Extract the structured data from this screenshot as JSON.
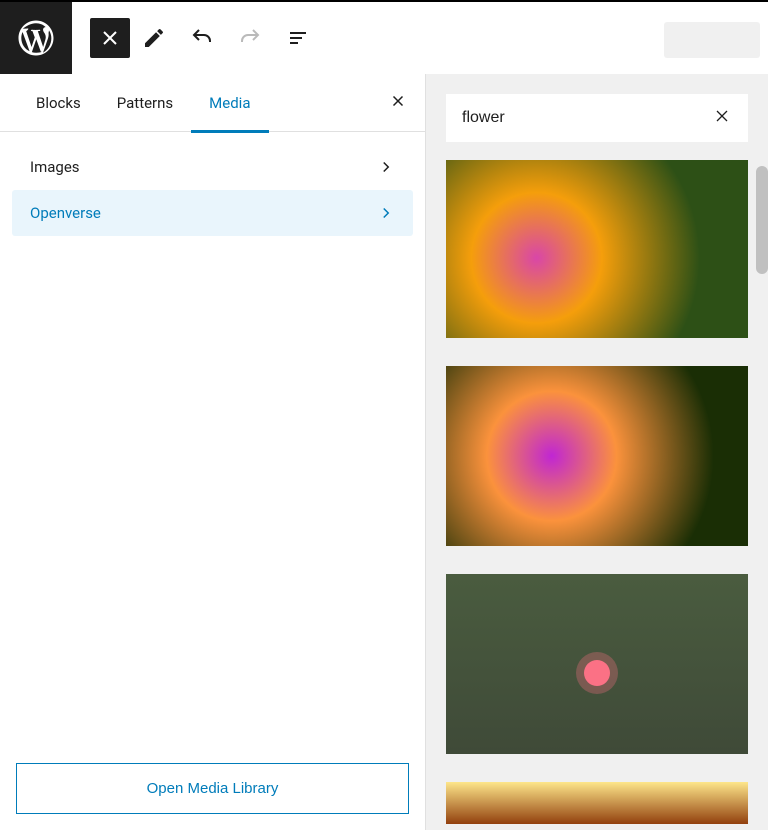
{
  "inserter": {
    "tabs": [
      {
        "label": "Blocks",
        "active": false
      },
      {
        "label": "Patterns",
        "active": false
      },
      {
        "label": "Media",
        "active": true
      }
    ],
    "categories": [
      {
        "label": "Images",
        "selected": false
      },
      {
        "label": "Openverse",
        "selected": true
      }
    ],
    "bottom_button": "Open Media Library"
  },
  "search": {
    "value": "flower"
  }
}
